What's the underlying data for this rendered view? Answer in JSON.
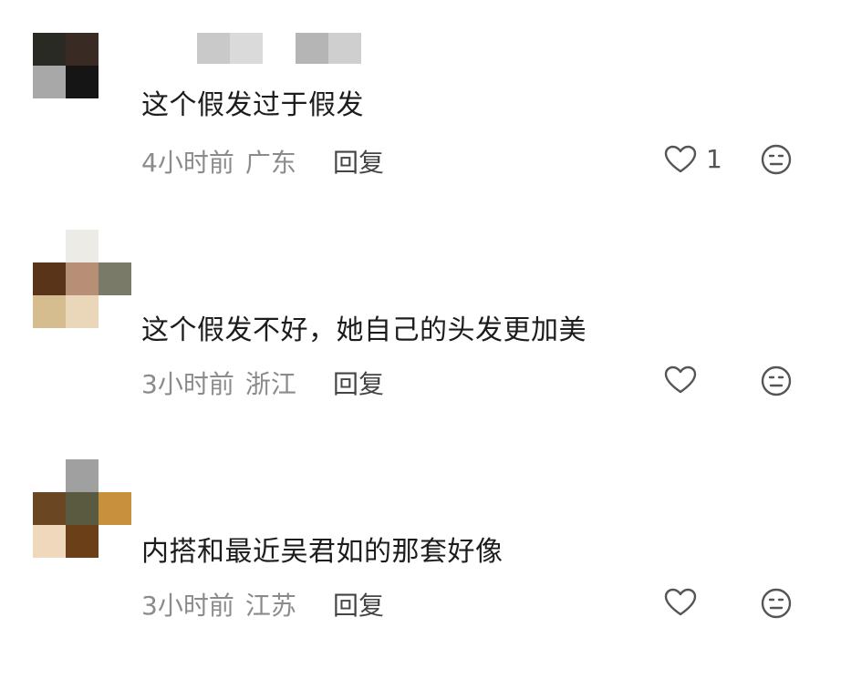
{
  "comments": [
    {
      "text": "这个假发过于假发",
      "time": "4小时前",
      "location": "广东",
      "reply_label": "回复",
      "likes": "1",
      "avatar_colors": [
        "#fff",
        "#fff",
        "#fff",
        "#2a2a24",
        "#3a2a24",
        "#fff",
        "#a8a8a8",
        "#151515",
        "#fff"
      ],
      "name_colors": [
        "#c9c9c9",
        "#dadada",
        "#fff",
        "#b5b5b5",
        "#cfcfcf"
      ]
    },
    {
      "text": "这个假发不好，她自己的头发更加美",
      "time": "3小时前",
      "location": "浙江",
      "reply_label": "回复",
      "likes": "",
      "avatar_colors": [
        "#fff",
        "#ecebe6",
        "#fff",
        "#5a3418",
        "#b78f77",
        "#7a7a68",
        "#d6bd90",
        "#ead6b8",
        "#fff"
      ],
      "name_colors": []
    },
    {
      "text": "内搭和最近吴君如的那套好像",
      "time": "3小时前",
      "location": "江苏",
      "reply_label": "回复",
      "likes": "",
      "avatar_colors": [
        "#fff",
        "#a0a0a0",
        "#fff",
        "#6a4622",
        "#5a5a40",
        "#c8903c",
        "#efd8bc",
        "#6b4018",
        "#fff"
      ],
      "name_colors": []
    }
  ],
  "icons": {
    "like": "heart-outline-icon",
    "emoji": "emoji-face-icon"
  }
}
